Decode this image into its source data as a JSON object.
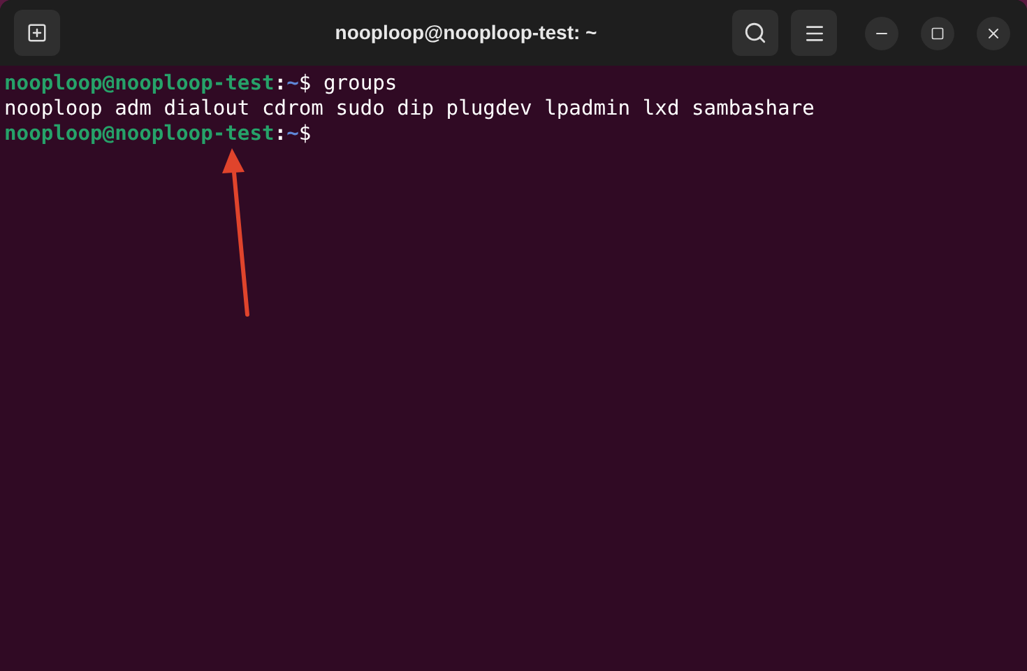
{
  "window": {
    "title": "nooploop@nooploop-test: ~"
  },
  "terminal": {
    "lines": [
      {
        "kind": "prompt",
        "user_host": "nooploop@nooploop-test",
        "separator": ":",
        "path": "~",
        "symbol": "$",
        "command": " groups"
      },
      {
        "kind": "output",
        "text": "nooploop adm dialout cdrom sudo dip plugdev lpadmin lxd sambashare"
      },
      {
        "kind": "prompt",
        "user_host": "nooploop@nooploop-test",
        "separator": ":",
        "path": "~",
        "symbol": "$"
      }
    ]
  }
}
